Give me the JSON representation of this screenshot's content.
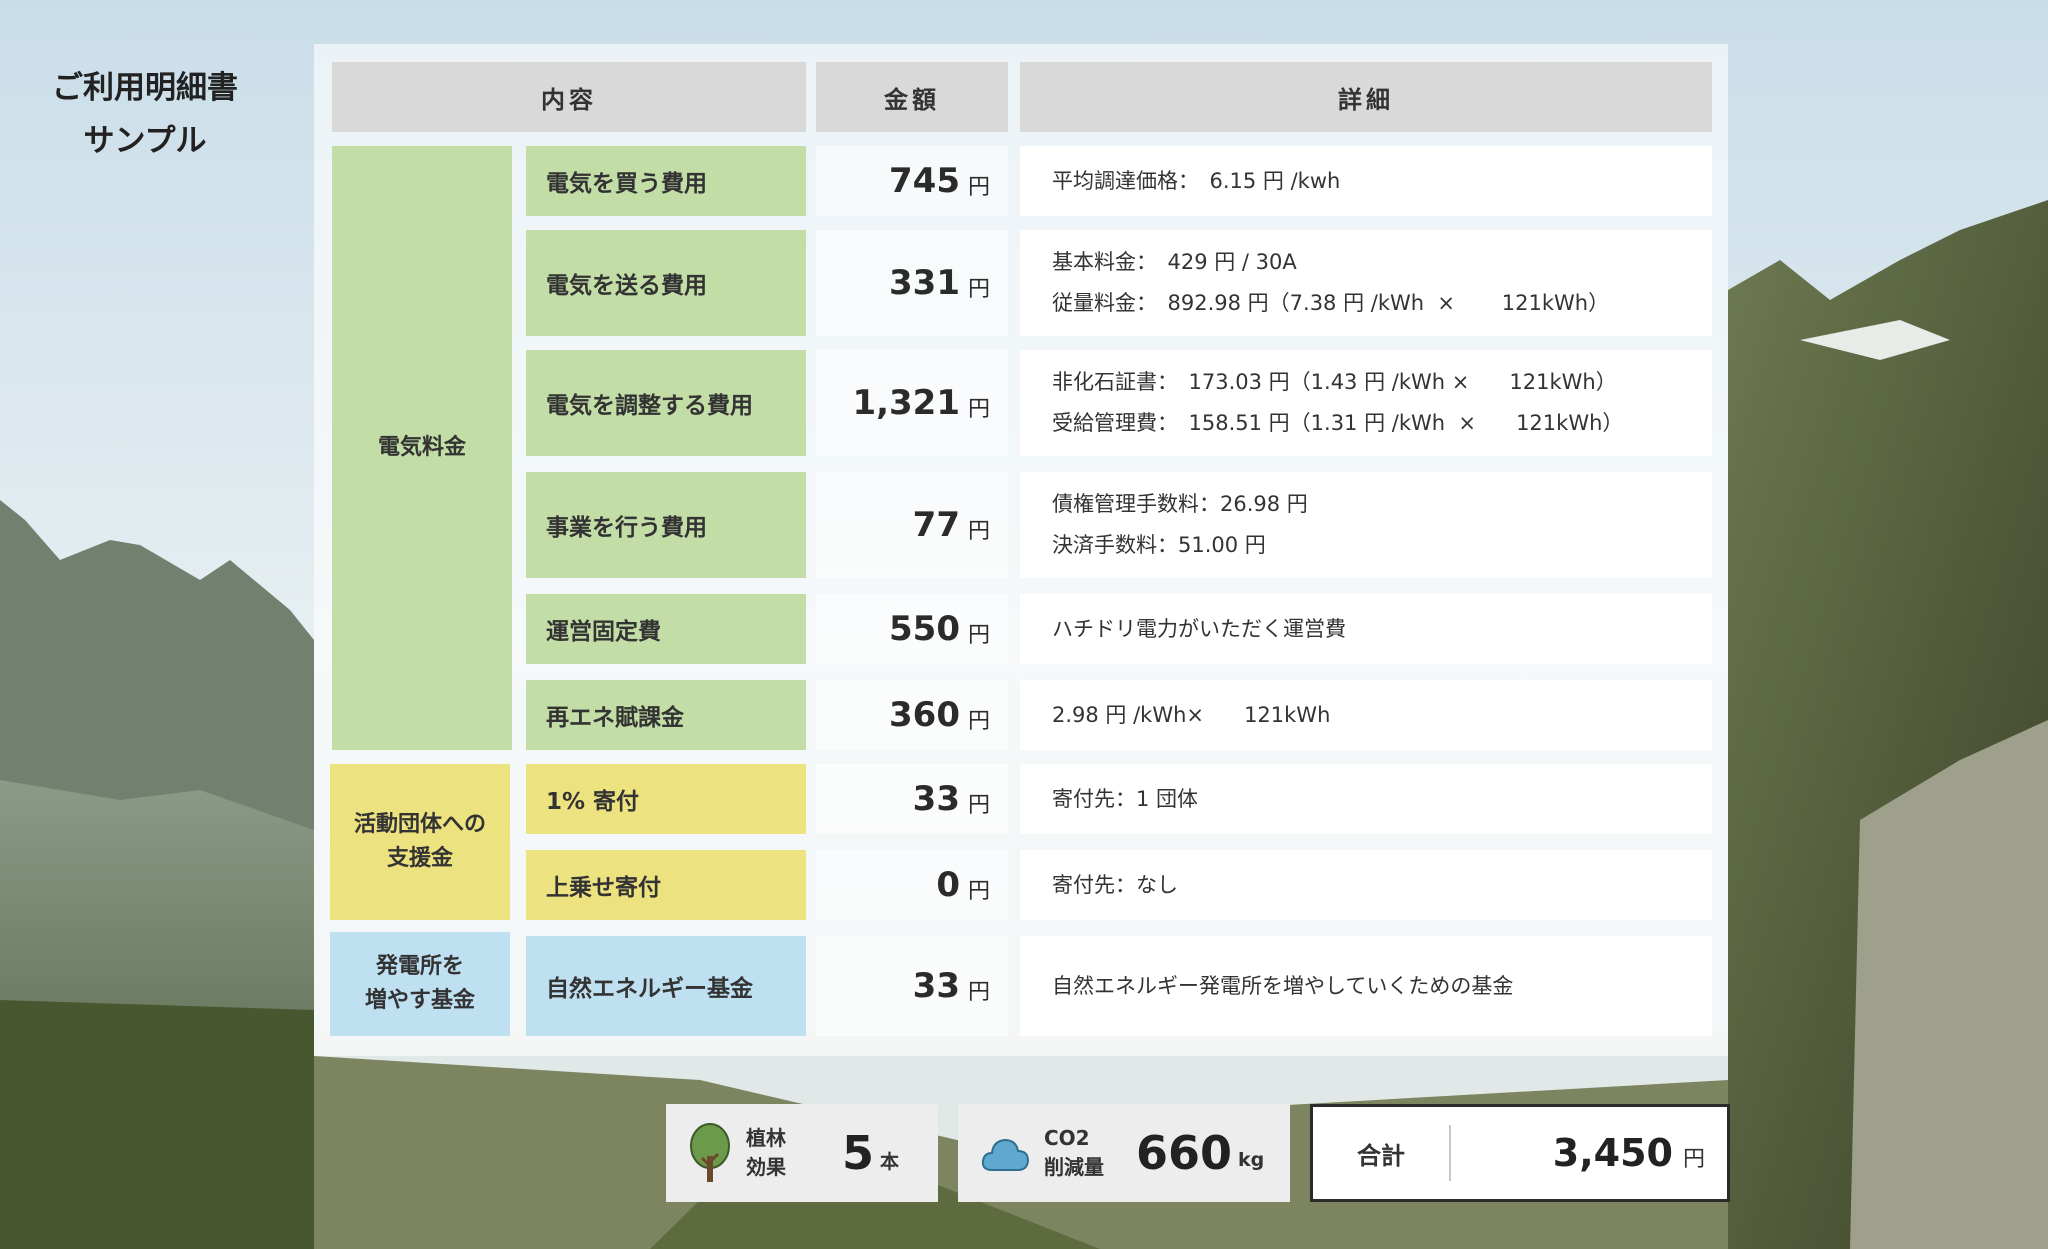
{
  "page_title": [
    "ご利用明細書",
    "サンプル"
  ],
  "headers": {
    "content": "内容",
    "amount": "金額",
    "detail": "詳細"
  },
  "groups": {
    "electricity": "電気料金",
    "support": "活動団体への\n支援金",
    "fund": "発電所を\n増やす基金"
  },
  "unit": "円",
  "rows": [
    {
      "item": "電気を買う費用",
      "amount": "745",
      "details": [
        "平均調達価格：　6.15 円 /kwh"
      ]
    },
    {
      "item": "電気を送る費用",
      "amount": "331",
      "details": [
        "基本料金：　429 円 / 30A",
        "従量料金：　892.98 円（7.38 円 /kWh  ×       121kWh）"
      ]
    },
    {
      "item": "電気を調整する費用",
      "amount": "1,321",
      "details": [
        "非化石証書：　173.03 円（1.43 円 /kWh ×      121kWh）",
        "受給管理費：　158.51 円（1.31 円 /kWh  ×      121kWh）"
      ]
    },
    {
      "item": "事業を行う費用",
      "amount": "77",
      "details": [
        "債権管理手数料：26.98 円",
        "決済手数料：51.00 円"
      ]
    },
    {
      "item": "運営固定費",
      "amount": "550",
      "details": [
        "ハチドリ電力がいただく運営費"
      ]
    },
    {
      "item": "再エネ賦課金",
      "amount": "360",
      "details": [
        "2.98 円 /kWh×      121kWh"
      ]
    },
    {
      "item": "1% 寄付",
      "amount": "33",
      "details": [
        "寄付先：1 団体"
      ]
    },
    {
      "item": "上乗せ寄付",
      "amount": "0",
      "details": [
        "寄付先：なし"
      ]
    },
    {
      "item": "自然エネルギー基金",
      "amount": "33",
      "details": [
        "自然エネルギー発電所を増やしていくための基金"
      ]
    }
  ],
  "footer": {
    "trees": {
      "label": "植林\n効果",
      "value": "5",
      "unit": "本",
      "icon": "tree-icon"
    },
    "co2": {
      "label": "CO2\n削減量",
      "value": "660",
      "unit": "kg",
      "icon": "cloud-icon"
    },
    "total": {
      "label": "合計",
      "value": "3,450",
      "unit": "円"
    }
  },
  "colors": {
    "electricity_green": "#c3dda7",
    "support_yellow": "#ece27f",
    "fund_blue": "#bfe0f1",
    "header_gray": "#d9d9d9",
    "tree_green": "#6a9a4a",
    "cloud_blue": "#5fa8cf"
  }
}
